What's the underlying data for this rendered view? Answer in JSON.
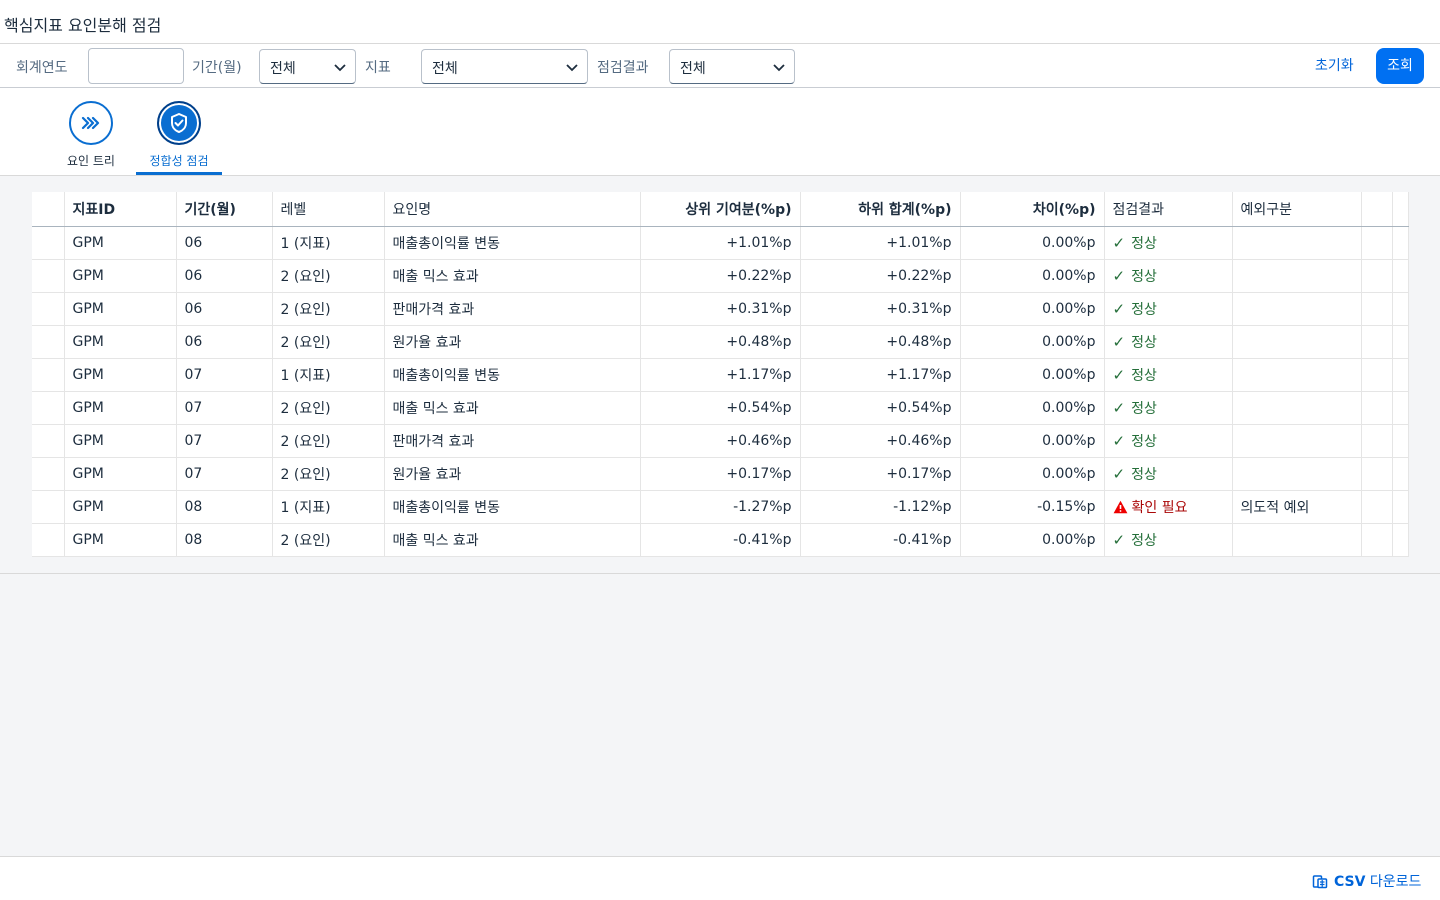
{
  "page": {
    "title": "핵심지표 요인분해 점검"
  },
  "filters": {
    "year_label": "회계연도",
    "year_value": "",
    "period_label": "기간(월)",
    "period_value": "전체",
    "metric_label": "지표",
    "metric_value": "전체",
    "result_label": "점검결과",
    "result_value": "전체",
    "reset_label": "초기화",
    "search_label": "조회"
  },
  "tabs": [
    {
      "label": "요인 트리",
      "icon": "chevrons-right-icon",
      "active": false
    },
    {
      "label": "정합성 점검",
      "icon": "shield-check-icon",
      "active": true
    }
  ],
  "table": {
    "columns": [
      "지표ID",
      "기간(월)",
      "레벨",
      "요인명",
      "상위 기여분(%p)",
      "하위 합계(%p)",
      "차이(%p)",
      "점검결과",
      "예외구분"
    ],
    "rows": [
      {
        "id": "GPM",
        "period": "06",
        "level": "1 (지표)",
        "factor": "매출총이익률 변동",
        "upper": "+1.01%p",
        "lower": "+1.01%p",
        "diff": "0.00%p",
        "result": "정상",
        "status": "ok",
        "exception": ""
      },
      {
        "id": "GPM",
        "period": "06",
        "level": "2 (요인)",
        "factor": "매출 믹스 효과",
        "upper": "+0.22%p",
        "lower": "+0.22%p",
        "diff": "0.00%p",
        "result": "정상",
        "status": "ok",
        "exception": ""
      },
      {
        "id": "GPM",
        "period": "06",
        "level": "2 (요인)",
        "factor": "판매가격 효과",
        "upper": "+0.31%p",
        "lower": "+0.31%p",
        "diff": "0.00%p",
        "result": "정상",
        "status": "ok",
        "exception": ""
      },
      {
        "id": "GPM",
        "period": "06",
        "level": "2 (요인)",
        "factor": "원가율 효과",
        "upper": "+0.48%p",
        "lower": "+0.48%p",
        "diff": "0.00%p",
        "result": "정상",
        "status": "ok",
        "exception": ""
      },
      {
        "id": "GPM",
        "period": "07",
        "level": "1 (지표)",
        "factor": "매출총이익률 변동",
        "upper": "+1.17%p",
        "lower": "+1.17%p",
        "diff": "0.00%p",
        "result": "정상",
        "status": "ok",
        "exception": ""
      },
      {
        "id": "GPM",
        "period": "07",
        "level": "2 (요인)",
        "factor": "매출 믹스 효과",
        "upper": "+0.54%p",
        "lower": "+0.54%p",
        "diff": "0.00%p",
        "result": "정상",
        "status": "ok",
        "exception": ""
      },
      {
        "id": "GPM",
        "period": "07",
        "level": "2 (요인)",
        "factor": "판매가격 효과",
        "upper": "+0.46%p",
        "lower": "+0.46%p",
        "diff": "0.00%p",
        "result": "정상",
        "status": "ok",
        "exception": ""
      },
      {
        "id": "GPM",
        "period": "07",
        "level": "2 (요인)",
        "factor": "원가율 효과",
        "upper": "+0.17%p",
        "lower": "+0.17%p",
        "diff": "0.00%p",
        "result": "정상",
        "status": "ok",
        "exception": ""
      },
      {
        "id": "GPM",
        "period": "08",
        "level": "1 (지표)",
        "factor": "매출총이익률 변동",
        "upper": "-1.27%p",
        "lower": "-1.12%p",
        "diff": "-0.15%p",
        "result": "확인 필요",
        "status": "warn",
        "exception": "의도적 예외"
      },
      {
        "id": "GPM",
        "period": "08",
        "level": "2 (요인)",
        "factor": "매출 믹스 효과",
        "upper": "-0.41%p",
        "lower": "-0.41%p",
        "diff": "0.00%p",
        "result": "정상",
        "status": "ok",
        "exception": ""
      }
    ]
  },
  "footer": {
    "csv_bold": "CSV",
    "csv_text": " 다운로드"
  },
  "colors": {
    "accent": "#0070f2",
    "ok": "#256f3a",
    "warn": "#aa0808"
  }
}
